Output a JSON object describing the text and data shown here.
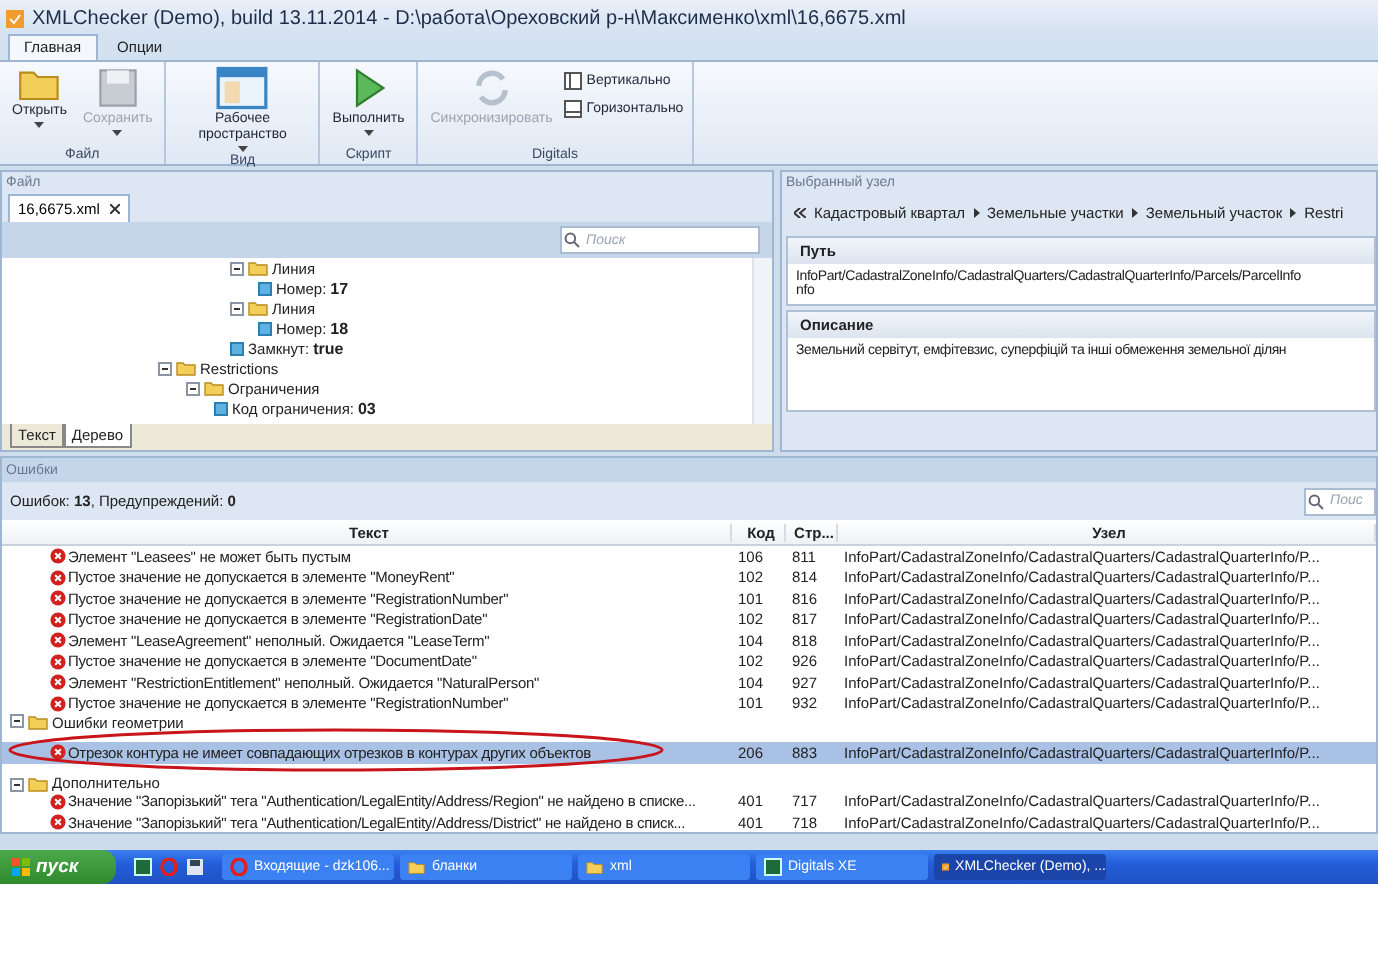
{
  "window": {
    "title": "XMLChecker (Demo), build 13.11.2014 - D:\\работа\\Ореховский р-н\\Максименко\\xml\\16,6675.xml"
  },
  "ribbon_tabs": [
    {
      "label": "Главная",
      "selected": true
    },
    {
      "label": "Опции",
      "selected": false
    }
  ],
  "ribbon_groups": [
    {
      "label": "Файл",
      "buttons": [
        {
          "label": "Открыть",
          "disabled": false,
          "dropdown": true
        },
        {
          "label": "Сохранить",
          "disabled": true,
          "dropdown": true
        }
      ]
    },
    {
      "label": "Вид",
      "buttons": [
        {
          "label": "Рабочее пространство",
          "disabled": false,
          "dropdown": true
        }
      ]
    },
    {
      "label": "Скрипт",
      "buttons": [
        {
          "label": "Выполнить",
          "disabled": false,
          "dropdown": true
        }
      ]
    },
    {
      "label": "Digitals",
      "buttons": [
        {
          "label": "Синхронизировать",
          "disabled": true
        }
      ],
      "options": [
        "Вертикально",
        "Горизонтально"
      ]
    }
  ],
  "file_panel": {
    "title": "Файл",
    "document_tab": "16,6675.xml",
    "search": {
      "placeholder": "Поиск"
    },
    "tree": [
      {
        "kind": "branch",
        "children": [
          {
            "kind": "branch",
            "children": [
              {
                "kind": "folder",
                "label": "Линия",
                "expanded": true,
                "children": [
                  {
                    "kind": "field",
                    "label": "Номер:",
                    "value": "17"
                  }
                ]
              },
              {
                "kind": "folder",
                "label": "Линия",
                "expanded": true,
                "children": [
                  {
                    "kind": "field",
                    "label": "Номер:",
                    "value": "18"
                  }
                ]
              },
              {
                "kind": "field",
                "label": "Замкнут:",
                "value": "true"
              }
            ]
          }
        ]
      },
      {
        "kind": "folder",
        "label": "Restrictions",
        "expanded": true,
        "children": [
          {
            "kind": "folder",
            "label": "Ограничения",
            "expanded": true,
            "children": [
              {
                "kind": "field",
                "label": "Код ограничения:",
                "value": "03"
              }
            ]
          }
        ]
      }
    ],
    "view_tabs": [
      {
        "label": "Текст",
        "selected": false
      },
      {
        "label": "Дерево",
        "selected": true
      }
    ]
  },
  "selected_node": {
    "title": "Выбранный узел",
    "breadcrumb": [
      "Кадастровый квартал",
      "Земельные участки",
      "Земельный участок",
      "Restri"
    ],
    "sections": [
      {
        "heading": "Путь",
        "lines": [
          "InfoPart/CadastralZoneInfo/CadastralQuarters/CadastralQuarterInfo/Parcels/ParcelInfo",
          "nfo"
        ]
      },
      {
        "heading": "Описание",
        "lines": [
          "Земельний сервітут, емфітевзис, суперфіцій та інші обмеження земельної ділян"
        ]
      }
    ]
  },
  "errors_panel": {
    "title": "Ошибки",
    "summary": "Ошибок: **13**, Предупреждений: **0**",
    "search": {
      "placeholder": "Поис"
    },
    "columns": [
      "Текст",
      "Код",
      "Стр...",
      "Узел"
    ],
    "rows": [
      {
        "kind": "error",
        "text": "Элемент \"Leasees\" не может быть пустым",
        "code": "106",
        "line": "811",
        "node": "InfoPart/CadastralZoneInfo/CadastralQuarters/CadastralQuarterInfo/P...",
        "selected": false
      },
      {
        "kind": "error",
        "text": "Пустое значение не допускается в элементе \"MoneyRent\"",
        "code": "102",
        "line": "814",
        "node": "InfoPart/CadastralZoneInfo/CadastralQuarters/CadastralQuarterInfo/P...",
        "selected": false
      },
      {
        "kind": "error",
        "text": "Пустое значение не допускается в элементе \"RegistrationNumber\"",
        "code": "101",
        "line": "816",
        "node": "InfoPart/CadastralZoneInfo/CadastralQuarters/CadastralQuarterInfo/P...",
        "selected": false
      },
      {
        "kind": "error",
        "text": "Пустое значение не допускается в элементе \"RegistrationDate\"",
        "code": "102",
        "line": "817",
        "node": "InfoPart/CadastralZoneInfo/CadastralQuarters/CadastralQuarterInfo/P...",
        "selected": false
      },
      {
        "kind": "error",
        "text": "Элемент \"LeaseAgreement\" неполный. Ожидается \"LeaseTerm\"",
        "code": "104",
        "line": "818",
        "node": "InfoPart/CadastralZoneInfo/CadastralQuarters/CadastralQuarterInfo/P...",
        "selected": false
      },
      {
        "kind": "error",
        "text": "Пустое значение не допускается в элементе \"DocumentDate\"",
        "code": "102",
        "line": "926",
        "node": "InfoPart/CadastralZoneInfo/CadastralQuarters/CadastralQuarterInfo/P...",
        "selected": false
      },
      {
        "kind": "error",
        "text": "Элемент \"RestrictionEntitlement\" неполный. Ожидается \"NaturalPerson\"",
        "code": "104",
        "line": "927",
        "node": "InfoPart/CadastralZoneInfo/CadastralQuarters/CadastralQuarterInfo/P...",
        "selected": false
      },
      {
        "kind": "error",
        "text": "Пустое значение не допускается в элементе \"RegistrationNumber\"",
        "code": "101",
        "line": "932",
        "node": "InfoPart/CadastralZoneInfo/CadastralQuarters/CadastralQuarterInfo/P...",
        "selected": false
      },
      {
        "kind": "group",
        "label": "Ошибки геометрии",
        "expanded": true
      },
      {
        "kind": "error",
        "text": "Отрезок контура не имеет совпадающих отрезков в контурах других объектов",
        "code": "206",
        "line": "883",
        "node": "InfoPart/CadastralZoneInfo/CadastralQuarters/CadastralQuarterInfo/P...",
        "selected": true
      },
      {
        "kind": "group",
        "label": "Дополнительно",
        "expanded": true
      },
      {
        "kind": "error",
        "text": "Значение \"Запорізький\" тега \"Authentication/LegalEntity/Address/Region\" не найдено в списке...",
        "code": "401",
        "line": "717",
        "node": "InfoPart/CadastralZoneInfo/CadastralQuarters/CadastralQuarterInfo/P...",
        "selected": false
      },
      {
        "kind": "error",
        "text": "Значение \"Запорізький\" тега \"Authentication/LegalEntity/Address/District\" не найдено в списк...",
        "code": "401",
        "line": "718",
        "node": "InfoPart/CadastralZoneInfo/CadastralQuarters/CadastralQuarterInfo/P...",
        "selected": false
      }
    ]
  },
  "taskbar": {
    "start": "пуск",
    "tasks": [
      {
        "label": "Входящие - dzk106...",
        "selected": false
      },
      {
        "label": "бланки",
        "selected": false
      },
      {
        "label": "xml",
        "selected": false
      },
      {
        "label": "Digitals XE",
        "selected": false
      },
      {
        "label": "XMLChecker (Demo), ...",
        "selected": true
      }
    ]
  }
}
